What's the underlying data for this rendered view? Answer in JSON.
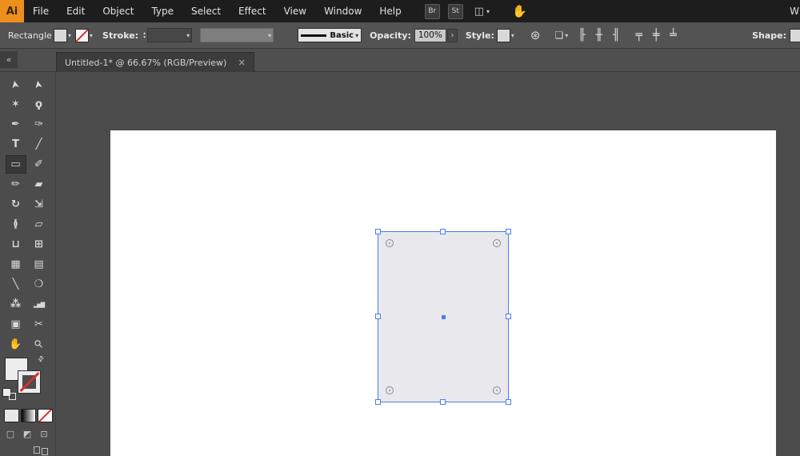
{
  "app": {
    "logo_text": "Ai",
    "bridge_button": "Br",
    "stock_button": "St",
    "workspace_partial": "W"
  },
  "menubar": {
    "items": [
      "File",
      "Edit",
      "Object",
      "Type",
      "Select",
      "Effect",
      "View",
      "Window",
      "Help"
    ]
  },
  "control_bar": {
    "tool_name": "Rectangle",
    "stroke_label": "Stroke:",
    "stroke_style_value": "Basic",
    "opacity_label": "Opacity:",
    "opacity_value": "100%",
    "style_label": "Style:",
    "shape_label": "Shape:"
  },
  "document_tab": {
    "title": "Untitled-1* @ 66.67% (RGB/Preview)",
    "close_glyph": "×"
  },
  "toolbar": {
    "collapse_glyph": "«",
    "tools": [
      {
        "name": "selection-tool",
        "glyph": "➤"
      },
      {
        "name": "direct-selection-tool",
        "glyph": "➤"
      },
      {
        "name": "magic-wand-tool",
        "glyph": "✶"
      },
      {
        "name": "lasso-tool",
        "glyph": "ϙ"
      },
      {
        "name": "pen-tool",
        "glyph": "✒"
      },
      {
        "name": "curvature-tool",
        "glyph": "✑"
      },
      {
        "name": "type-tool",
        "glyph": "T"
      },
      {
        "name": "line-segment-tool",
        "glyph": "╱"
      },
      {
        "name": "rectangle-tool",
        "glyph": "▭"
      },
      {
        "name": "paintbrush-tool",
        "glyph": "✐"
      },
      {
        "name": "shaper-tool",
        "glyph": "✏"
      },
      {
        "name": "eraser-tool",
        "glyph": "▰"
      },
      {
        "name": "rotate-tool",
        "glyph": "↻"
      },
      {
        "name": "scale-tool",
        "glyph": "⇲"
      },
      {
        "name": "width-tool",
        "glyph": "≬"
      },
      {
        "name": "free-transform-tool",
        "glyph": "▱"
      },
      {
        "name": "shape-builder-tool",
        "glyph": "⊔"
      },
      {
        "name": "perspective-grid-tool",
        "glyph": "⊞"
      },
      {
        "name": "mesh-tool",
        "glyph": "▦"
      },
      {
        "name": "gradient-tool",
        "glyph": "▤"
      },
      {
        "name": "eyedropper-tool",
        "glyph": "╲"
      },
      {
        "name": "blend-tool",
        "glyph": "❍"
      },
      {
        "name": "symbol-sprayer-tool",
        "glyph": "⁂"
      },
      {
        "name": "column-graph-tool",
        "glyph": "▂▅▇"
      },
      {
        "name": "artboard-tool",
        "glyph": "▣"
      },
      {
        "name": "slice-tool",
        "glyph": "✂"
      },
      {
        "name": "hand-tool",
        "glyph": "✋"
      },
      {
        "name": "zoom-tool",
        "glyph": "⚲"
      }
    ]
  },
  "icons": {
    "chevron_down": "▾",
    "spinner_up": "▴",
    "spinner_down": "▾",
    "opacity_arrow": "›",
    "recolor_wheel": "⊛",
    "transform": "❏",
    "align_left": "╟",
    "align_center": "╫",
    "align_right": "╢",
    "distribute_top": "╤",
    "distribute_middle": "╪",
    "distribute_bottom": "╧",
    "arrange_documents": "◫",
    "hand": "✋",
    "swap_fill_stroke": "⇄",
    "draw_normal": "▢",
    "draw_behind": "◩",
    "draw_inside": "⊡"
  },
  "colors": {
    "accent_blue": "#4a7cf0",
    "logo_orange": "#ed8f1c",
    "none_red": "#d5302f",
    "top_bar": "#1d1d1d",
    "panel": "#535353",
    "canvas": "#4c4c4c",
    "artboard": "#ffffff"
  }
}
